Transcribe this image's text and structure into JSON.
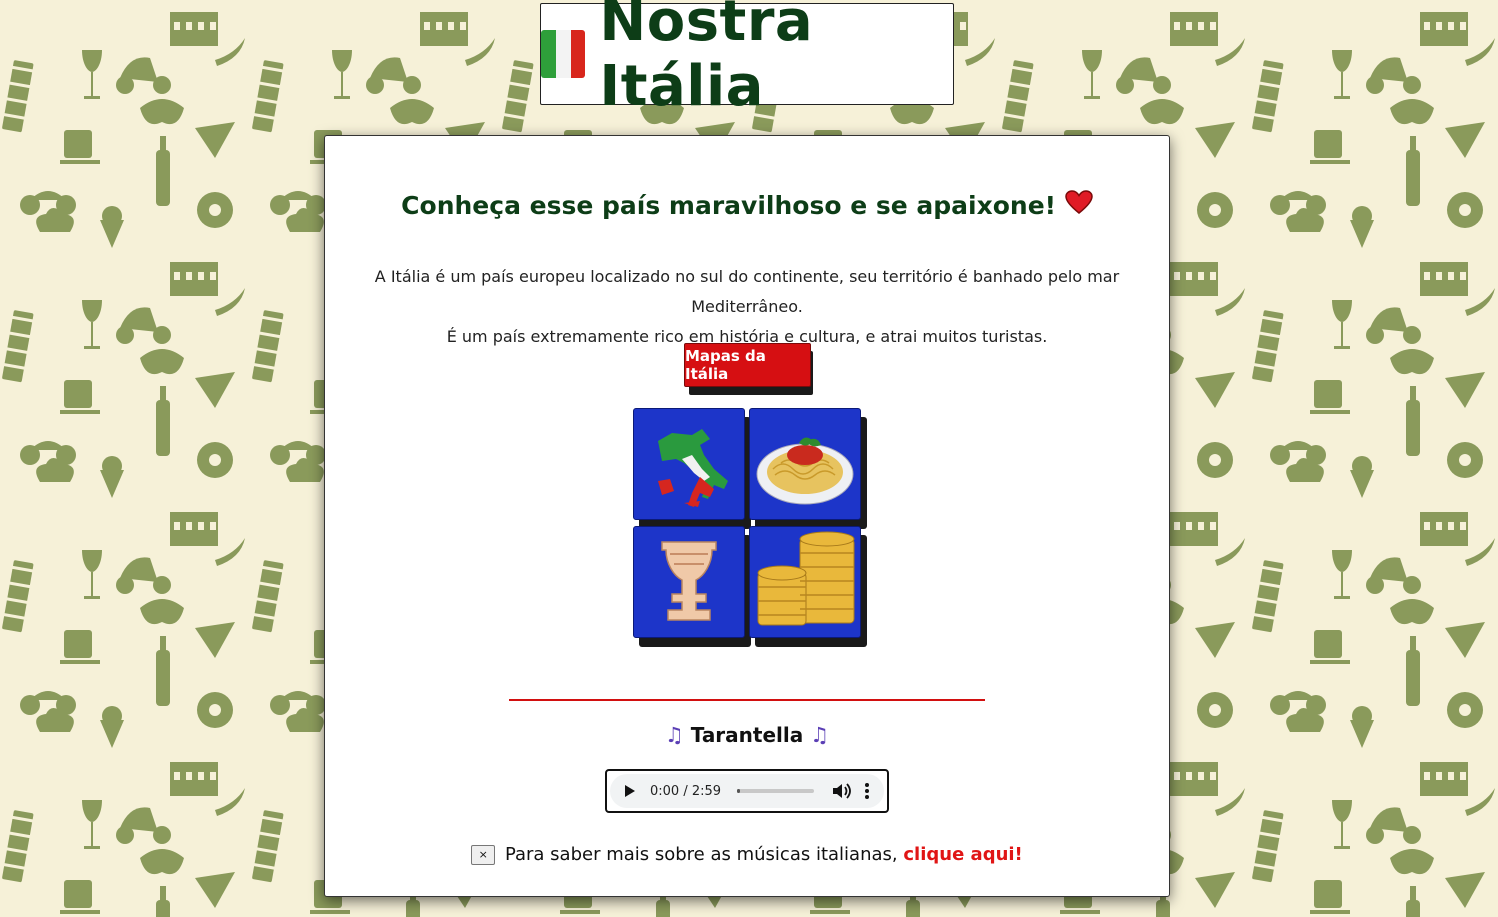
{
  "colors": {
    "background": "#f6f1d8",
    "pattern": "#8a9a5b",
    "title_green": "#0d3d17",
    "accent_red": "#d60f12",
    "tile_blue": "#1d35c9"
  },
  "header": {
    "flag_icon": "italy-flag-icon",
    "title": "Nostra Itália"
  },
  "main": {
    "headline": "Conheça esse país maravilhoso e se apaixone!",
    "headline_icon": "heart-icon",
    "intro_line_1": "A Itália é um país europeu localizado no sul do continente, seu território é banhado pelo mar Mediterrâneo.",
    "intro_line_2": "É um país extremamente rico em história e cultura, e atrai muitos turistas.",
    "maps_button": "Mapas da Itália",
    "tiles": [
      {
        "icon": "italy-map-icon"
      },
      {
        "icon": "spaghetti-icon"
      },
      {
        "icon": "vase-icon"
      },
      {
        "icon": "coins-icon"
      }
    ]
  },
  "music": {
    "note_icon": "music-note-icon",
    "title": "Tarantella",
    "player": {
      "time": "0:00 / 2:59",
      "progress": 0
    },
    "close_label": "×",
    "footer_text": "Para saber mais sobre as músicas italianas,",
    "footer_link": "clique aqui!"
  }
}
